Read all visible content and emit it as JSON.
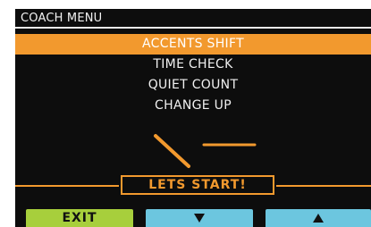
{
  "header": {
    "title": "COACH MENU"
  },
  "menu": {
    "items": [
      {
        "label": "ACCENTS SHIFT",
        "selected": true
      },
      {
        "label": "TIME CHECK",
        "selected": false
      },
      {
        "label": "QUIET COUNT",
        "selected": false
      },
      {
        "label": "CHANGE UP",
        "selected": false
      }
    ]
  },
  "start": {
    "label": "LETS START!"
  },
  "softkeys": {
    "exit_label": "EXIT",
    "down_icon": "triangle-down-icon",
    "up_icon": "triangle-up-icon"
  },
  "colors": {
    "accent": "#f2992e",
    "exit_key": "#a7cf3c",
    "arrow_keys": "#6cc6df",
    "background": "#0d0d0d"
  }
}
